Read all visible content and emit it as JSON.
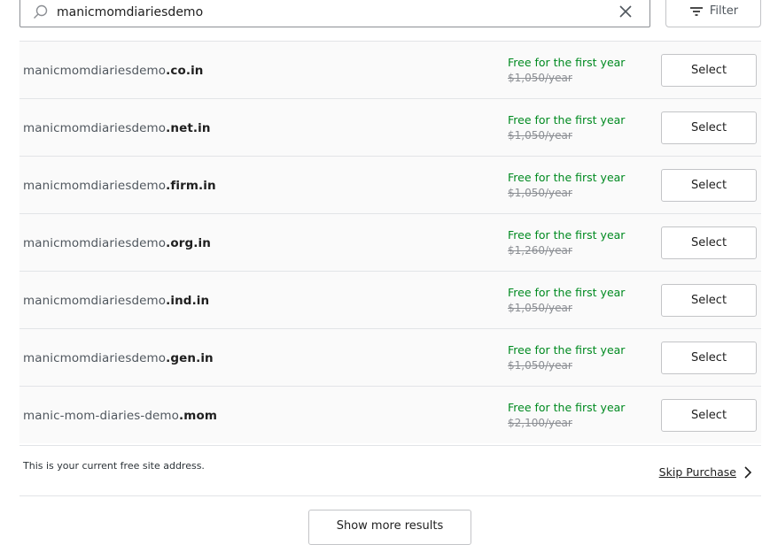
{
  "search": {
    "value": "manicmomdiariesdemo"
  },
  "filter": {
    "label": "Filter"
  },
  "rows": [
    {
      "domain_base": "manicmomdiariesdemo",
      "tld": ".co.in",
      "free_label": "Free for the first year",
      "original_price": "$1,050/year",
      "select_label": "Select"
    },
    {
      "domain_base": "manicmomdiariesdemo",
      "tld": ".net.in",
      "free_label": "Free for the first year",
      "original_price": "$1,050/year",
      "select_label": "Select"
    },
    {
      "domain_base": "manicmomdiariesdemo",
      "tld": ".firm.in",
      "free_label": "Free for the first year",
      "original_price": "$1,050/year",
      "select_label": "Select"
    },
    {
      "domain_base": "manicmomdiariesdemo",
      "tld": ".org.in",
      "free_label": "Free for the first year",
      "original_price": "$1,260/year",
      "select_label": "Select"
    },
    {
      "domain_base": "manicmomdiariesdemo",
      "tld": ".ind.in",
      "free_label": "Free for the first year",
      "original_price": "$1,050/year",
      "select_label": "Select"
    },
    {
      "domain_base": "manicmomdiariesdemo",
      "tld": ".gen.in",
      "free_label": "Free for the first year",
      "original_price": "$1,050/year",
      "select_label": "Select"
    },
    {
      "domain_base": "manic-mom-diaries-demo",
      "tld": ".mom",
      "free_label": "Free for the first year",
      "original_price": "$2,100/year",
      "select_label": "Select"
    }
  ],
  "free_site": {
    "note": "This is your current free site address.",
    "skip_label": "Skip Purchase"
  },
  "show_more": {
    "label": "Show more results"
  },
  "colors": {
    "free_green": "#008a20",
    "strike_gray": "#8c8f94"
  },
  "icons": {
    "search": "search-icon",
    "clear": "close-icon",
    "filter": "filter-icon",
    "skip": "chevron-right-icon"
  }
}
